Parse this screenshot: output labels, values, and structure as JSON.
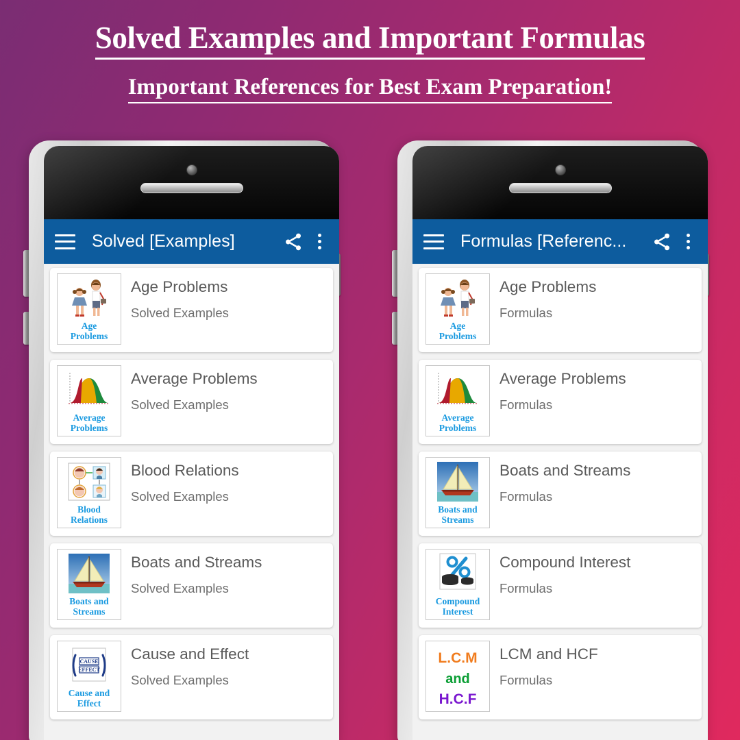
{
  "headings": {
    "line1": "Solved Examples and Important Formulas",
    "line2": "Important References for Best Exam Preparation!"
  },
  "theme": {
    "appbar_color": "#0d5c9e",
    "thumb_caption_color": "#1a9ae0",
    "background_start": "#7a2d73",
    "background_end": "#e0295e"
  },
  "phones": [
    {
      "appbar": {
        "menu_icon": "hamburger-menu-icon",
        "title": "Solved [Examples]",
        "share_icon": "share-icon",
        "overflow_icon": "more-vertical-icon"
      },
      "items": [
        {
          "art": "age",
          "caption": "Age\nProblems",
          "title": "Age Problems",
          "subtitle": "Solved Examples"
        },
        {
          "art": "average",
          "caption": "Average\nProblems",
          "title": "Average Problems",
          "subtitle": "Solved Examples"
        },
        {
          "art": "blood",
          "caption": "Blood\nRelations",
          "title": "Blood Relations",
          "subtitle": "Solved Examples"
        },
        {
          "art": "boat",
          "caption": "Boats and\nStreams",
          "title": "Boats and Streams",
          "subtitle": "Solved Examples"
        },
        {
          "art": "cause",
          "caption": "Cause and\nEffect",
          "title": "Cause and Effect",
          "subtitle": "Solved Examples"
        }
      ]
    },
    {
      "appbar": {
        "menu_icon": "hamburger-menu-icon",
        "title": "Formulas [Referenc...",
        "share_icon": "share-icon",
        "overflow_icon": "more-vertical-icon"
      },
      "items": [
        {
          "art": "age",
          "caption": "Age\nProblems",
          "title": "Age Problems",
          "subtitle": "Formulas"
        },
        {
          "art": "average",
          "caption": "Average\nProblems",
          "title": "Average Problems",
          "subtitle": "Formulas"
        },
        {
          "art": "boat",
          "caption": "Boats and\nStreams",
          "title": "Boats and Streams",
          "subtitle": "Formulas"
        },
        {
          "art": "compound",
          "caption": "Compound\nInterest",
          "title": "Compound Interest",
          "subtitle": "Formulas"
        },
        {
          "art": "lcm",
          "caption": "",
          "title": "LCM and HCF",
          "subtitle": "Formulas"
        }
      ]
    }
  ]
}
